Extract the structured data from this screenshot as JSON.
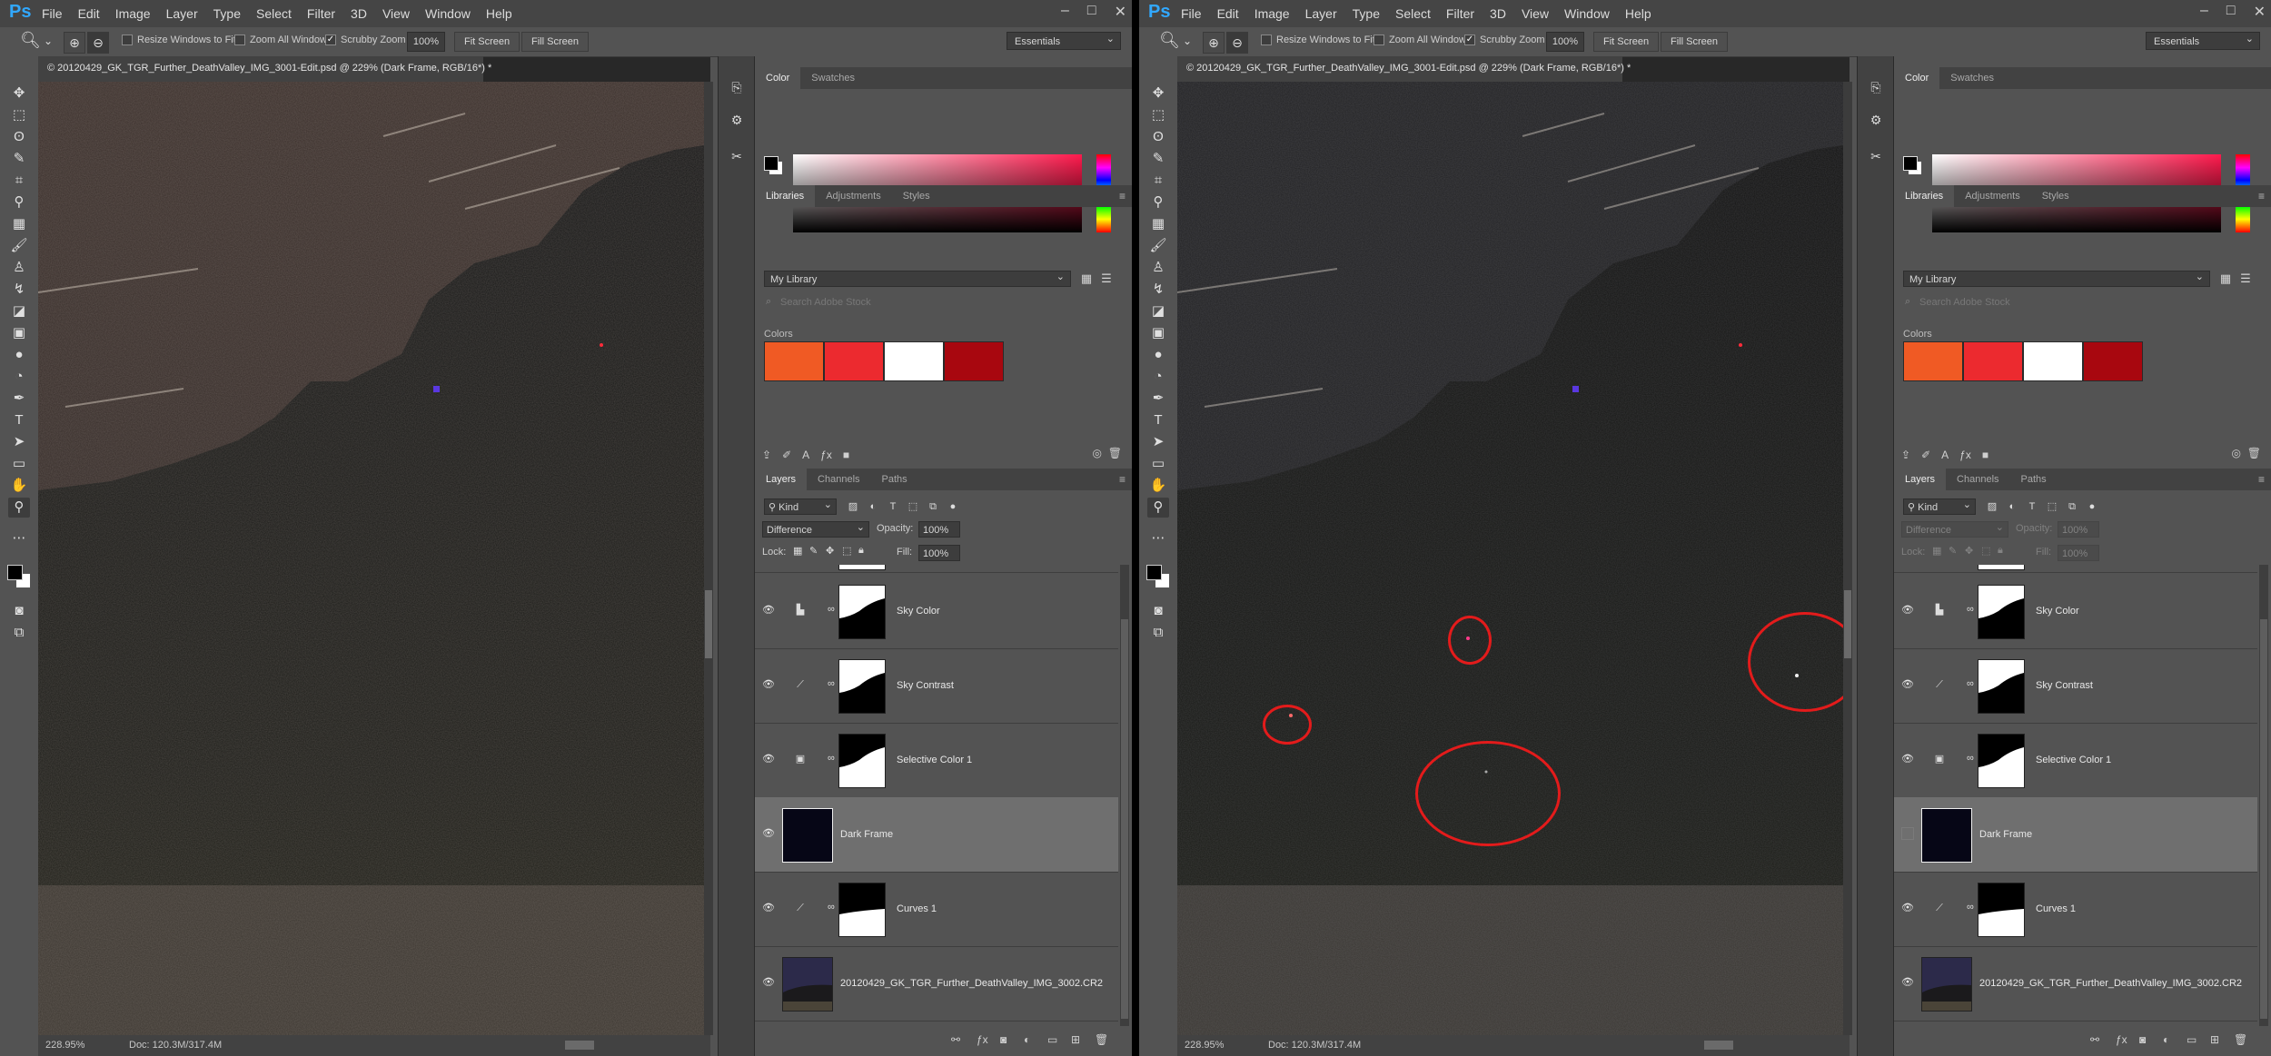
{
  "app": {
    "logo": "Ps",
    "menus": [
      "File",
      "Edit",
      "Image",
      "Layer",
      "Type",
      "Select",
      "Filter",
      "3D",
      "View",
      "Window",
      "Help"
    ],
    "window_controls": [
      "–",
      "□",
      "✕"
    ]
  },
  "options_bar": {
    "resize_windows": "Resize Windows to Fit",
    "zoom_all": "Zoom All Windows",
    "scrubby_zoom": "Scrubby Zoom",
    "zoom_value": "100%",
    "fit_screen": "Fit Screen",
    "fill_screen": "Fill Screen",
    "workspace": "Essentials"
  },
  "document": {
    "tab_title": "© 20120429_GK_TGR_Further_DeathValley_IMG_3001-Edit.psd @ 229% (Dark Frame, RGB/16*) *",
    "zoom": "228.95%",
    "doc_size": "Doc: 120.3M/317.4M"
  },
  "color_panel": {
    "tabs": [
      "Color",
      "Swatches"
    ],
    "hue_color": "#ff1a4d"
  },
  "libraries_panel": {
    "tabs": [
      "Libraries",
      "Adjustments",
      "Styles"
    ],
    "library": "My Library",
    "search_placeholder": "Search Adobe Stock",
    "colors_heading": "Colors",
    "swatches": [
      "#f05a24",
      "#ec2a2f",
      "#ffffff",
      "#a8070f"
    ]
  },
  "layers_panel": {
    "tabs": [
      "Layers",
      "Channels",
      "Paths"
    ],
    "kind": "Kind",
    "blend_mode": "Difference",
    "opacity_label": "Opacity:",
    "opacity": "100%",
    "lock_label": "Lock:",
    "fill_label": "Fill:",
    "fill": "100%",
    "layers": [
      {
        "name": "Sky Color",
        "type": "adjustment",
        "icon": "levels-icon",
        "visible": true
      },
      {
        "name": "Sky Contrast",
        "type": "adjustment",
        "icon": "curves-icon",
        "visible": true
      },
      {
        "name": "Selective Color 1",
        "type": "adjustment",
        "icon": "selective-color-icon",
        "visible": true
      },
      {
        "name": "Dark Frame",
        "type": "pixel",
        "selected": true,
        "visible_left": true,
        "visible_right": false
      },
      {
        "name": "Curves 1",
        "type": "adjustment",
        "icon": "curves-icon",
        "visible": true
      },
      {
        "name": "20120429_GK_TGR_Further_DeathValley_IMG_3002.CR2",
        "type": "photo",
        "visible": true
      }
    ]
  },
  "colors": {
    "accent": "#31a8ff",
    "annotation_circle": "#e31b1b"
  }
}
